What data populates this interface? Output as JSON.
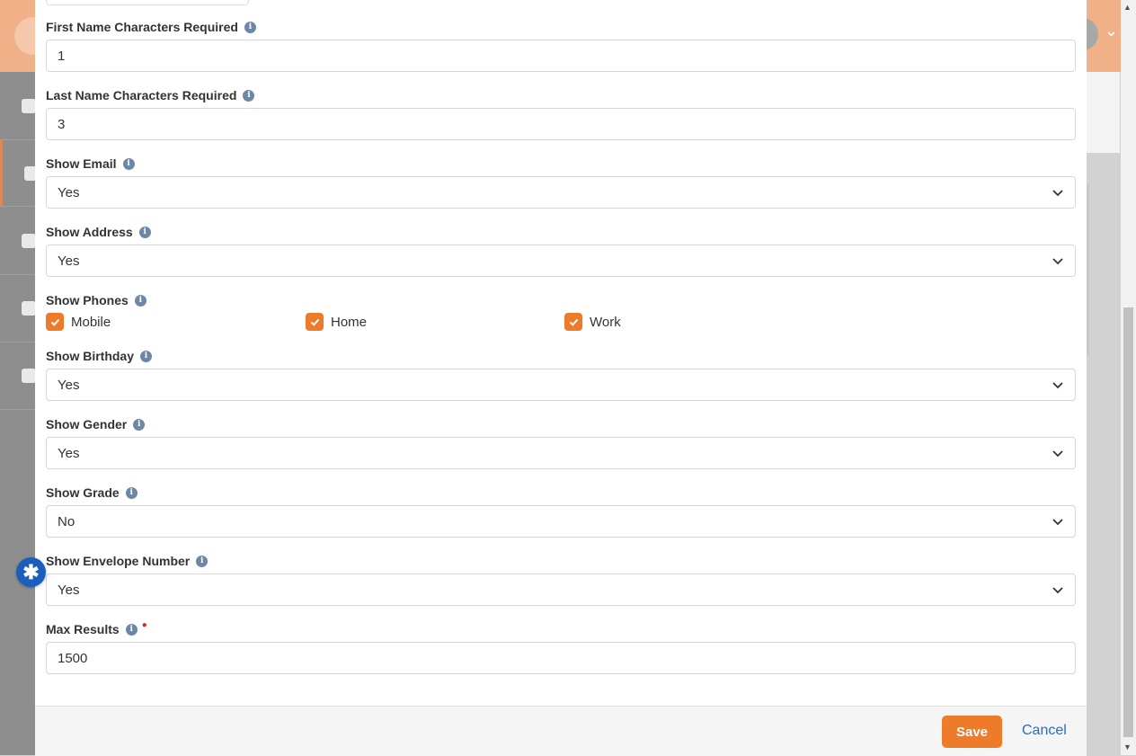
{
  "fields": {
    "first_name_chars": {
      "label": "First Name Characters Required",
      "value": "1"
    },
    "last_name_chars": {
      "label": "Last Name Characters Required",
      "value": "3"
    },
    "show_email": {
      "label": "Show Email",
      "value": "Yes"
    },
    "show_address": {
      "label": "Show Address",
      "value": "Yes"
    },
    "show_phones": {
      "label": "Show Phones",
      "options": [
        {
          "label": "Mobile",
          "checked": true
        },
        {
          "label": "Home",
          "checked": true
        },
        {
          "label": "Work",
          "checked": true
        }
      ]
    },
    "show_birthday": {
      "label": "Show Birthday",
      "value": "Yes"
    },
    "show_gender": {
      "label": "Show Gender",
      "value": "Yes"
    },
    "show_grade": {
      "label": "Show Grade",
      "value": "No"
    },
    "show_envelope": {
      "label": "Show Envelope Number",
      "value": "Yes"
    },
    "max_results": {
      "label": "Max Results",
      "value": "1500",
      "required": true
    }
  },
  "footer": {
    "save_label": "Save",
    "cancel_label": "Cancel"
  },
  "icons": {
    "info": "info-icon",
    "chevron": "chevron-down-icon",
    "check": "check-icon",
    "help": "asterisk-icon"
  },
  "colors": {
    "accent": "#ee7b2a",
    "link": "#2a6ebb",
    "info": "#6e87a6",
    "help": "#1a5fbd"
  }
}
